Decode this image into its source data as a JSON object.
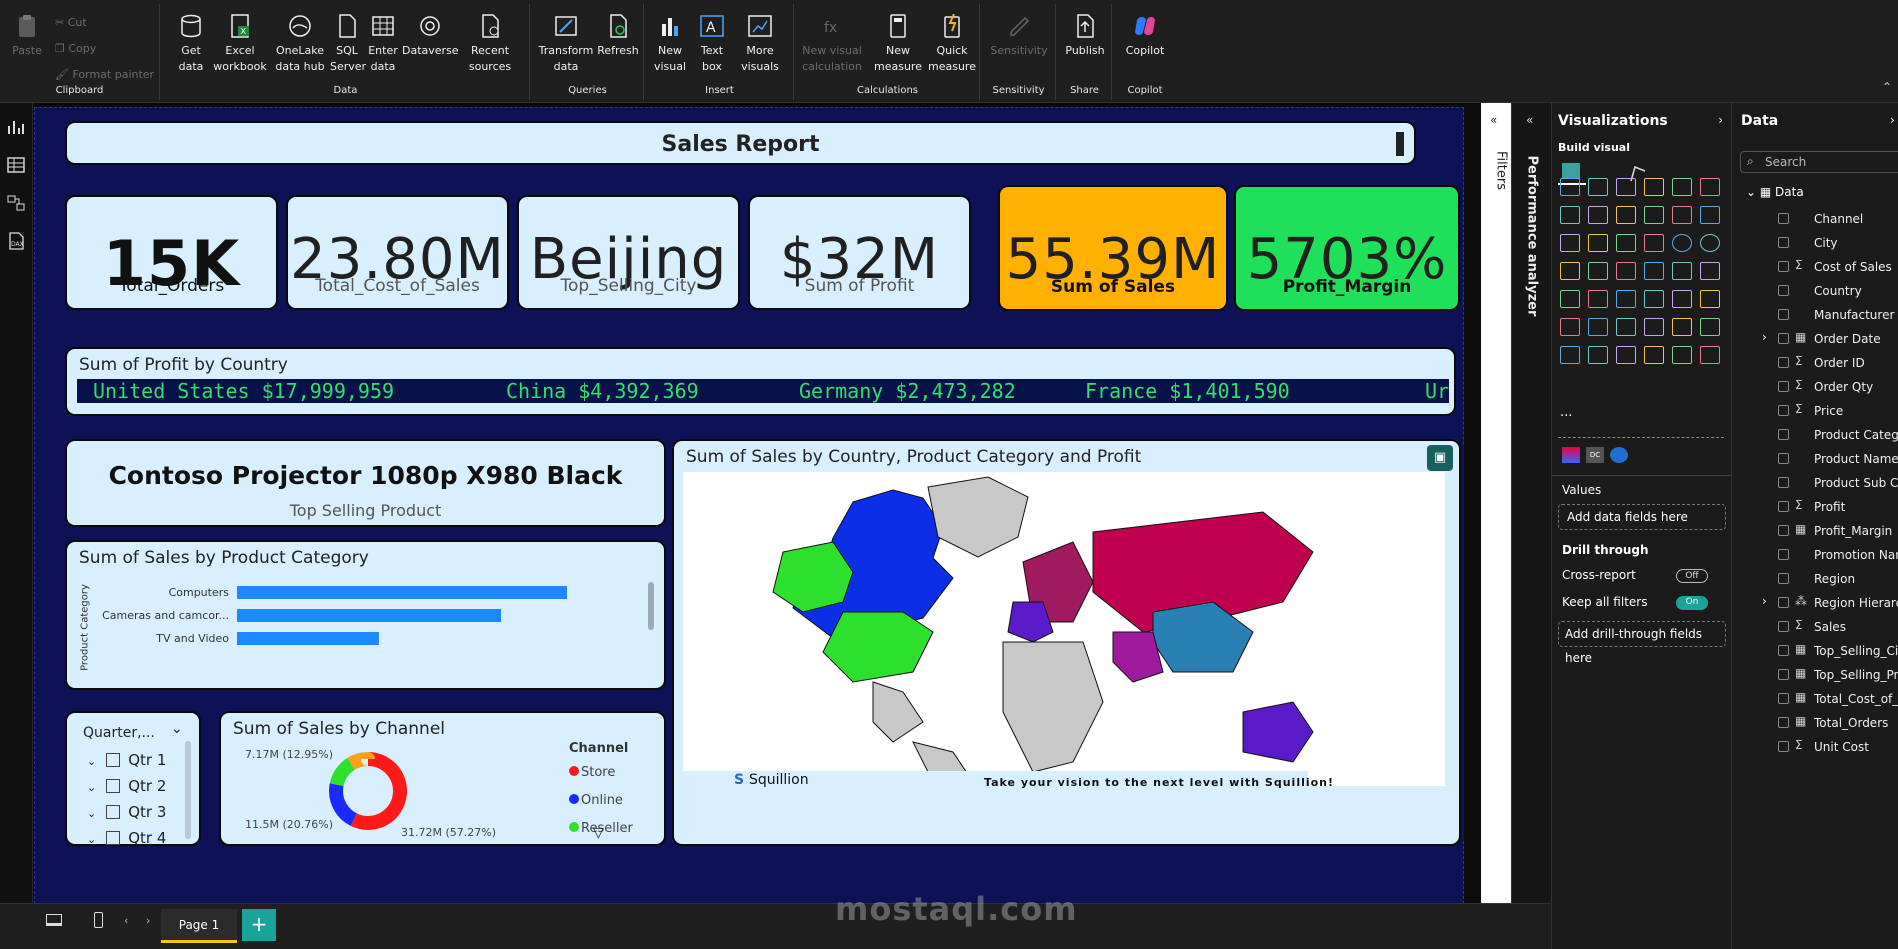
{
  "ribbon": {
    "clipboard": {
      "paste": "Paste",
      "cut": "Cut",
      "copy": "Copy",
      "format_painter": "Format painter",
      "group": "Clipboard"
    },
    "data": {
      "get_data": "Get data",
      "excel": "Excel workbook",
      "onelake": "OneLake data hub",
      "sql": "SQL Server",
      "enter": "Enter data",
      "dataverse": "Dataverse",
      "recent": "Recent sources",
      "group": "Data"
    },
    "queries": {
      "transform": "Transform data",
      "refresh": "Refresh",
      "group": "Queries"
    },
    "insert": {
      "new_visual": "New visual",
      "text_box": "Text box",
      "more_visuals": "More visuals",
      "group": "Insert"
    },
    "calculations": {
      "new_visual_calc": "New visual calculation",
      "new_measure": "New measure",
      "quick_measure": "Quick measure",
      "group": "Calculations"
    },
    "sensitivity": {
      "label": "Sensitivity",
      "group": "Sensitivity"
    },
    "share": {
      "publish": "Publish",
      "group": "Share"
    },
    "copilot": {
      "label": "Copilot",
      "group": "Copilot"
    }
  },
  "report": {
    "title": "Sales Report",
    "kpis": [
      {
        "value": "15K",
        "label": "Total_Orders"
      },
      {
        "value": "23.80M",
        "label": "Total_Cost_of_Sales"
      },
      {
        "value": "Beijing",
        "label": "Top_Selling_City"
      },
      {
        "value": "$32M",
        "label": "Sum of Profit"
      },
      {
        "value": "55.39M",
        "label": "Sum of Sales"
      },
      {
        "value": "5703%",
        "label": "Profit_Margin"
      }
    ],
    "ticker": {
      "title": "Sum of Profit by Country",
      "items": [
        "United States $17,999,959",
        "China $4,392,369",
        "Germany $2,473,282",
        "France $1,401,590",
        "Ur"
      ]
    },
    "top_product": {
      "value": "Contoso Projector 1080p X980 Black",
      "label": "Top Selling Product"
    },
    "map": {
      "title": "Sum of Sales by Country, Product Category and Profit",
      "brand": "Squillion",
      "tagline": "Take your vision to the next level with Squillion!"
    },
    "slicer": {
      "title": "Quarter,...",
      "items": [
        "Qtr 1",
        "Qtr 2",
        "Qtr 3",
        "Qtr 4"
      ]
    }
  },
  "chart_data": [
    {
      "type": "bar",
      "title": "Sum of Sales by Product Category",
      "ylabel": "Product Category",
      "categories": [
        "Computers",
        "Cameras and camcor...",
        "TV and Video"
      ],
      "values": [
        100,
        80,
        43
      ],
      "color": "#1e88ff"
    },
    {
      "type": "pie",
      "title": "Sum of Sales by Channel",
      "legend_title": "Channel",
      "labels": [
        "Store",
        "Online",
        "Reseller"
      ],
      "values": [
        31.72,
        11.5,
        7.17
      ],
      "data_labels": [
        "31.72M (57.27%)",
        "11.5M (20.76%)",
        "7.17M (12.95%)"
      ],
      "colors": [
        "#ff1a1a",
        "#1a2bff",
        "#2ee02e",
        "#ff9f1a"
      ]
    }
  ],
  "panes": {
    "filters": "Filters",
    "performance": "Performance analyzer",
    "visualizations": {
      "title": "Visualizations",
      "build": "Build visual",
      "values": "Values",
      "add_data": "Add data fields here",
      "drill": "Drill through",
      "cross": "Cross-report",
      "cross_state": "Off",
      "keep": "Keep all filters",
      "keep_state": "On",
      "add_drill": "Add drill-through fields here"
    },
    "data": {
      "title": "Data",
      "search_placeholder": "Search",
      "table": "Data",
      "fields": [
        {
          "sig": "",
          "name": "Channel"
        },
        {
          "sig": "",
          "name": "City"
        },
        {
          "sig": "Σ",
          "name": "Cost of Sales"
        },
        {
          "sig": "",
          "name": "Country"
        },
        {
          "sig": "",
          "name": "Manufacturer"
        },
        {
          "sig": "▦",
          "name": "Order Date"
        },
        {
          "sig": "Σ",
          "name": "Order ID"
        },
        {
          "sig": "Σ",
          "name": "Order Qty"
        },
        {
          "sig": "Σ",
          "name": "Price"
        },
        {
          "sig": "",
          "name": "Product Category"
        },
        {
          "sig": "",
          "name": "Product Name"
        },
        {
          "sig": "",
          "name": "Product Sub Ca..."
        },
        {
          "sig": "Σ",
          "name": "Profit"
        },
        {
          "sig": "▦",
          "name": "Profit_Margin"
        },
        {
          "sig": "",
          "name": "Promotion Name"
        },
        {
          "sig": "",
          "name": "Region"
        },
        {
          "sig": "⁂",
          "name": "Region Hierarchy"
        },
        {
          "sig": "Σ",
          "name": "Sales"
        },
        {
          "sig": "▦",
          "name": "Top_Selling_City"
        },
        {
          "sig": "▦",
          "name": "Top_Selling_Pro..."
        },
        {
          "sig": "▦",
          "name": "Total_Cost_of_S..."
        },
        {
          "sig": "▦",
          "name": "Total_Orders"
        },
        {
          "sig": "Σ",
          "name": "Unit Cost"
        }
      ]
    }
  },
  "footer": {
    "page": "Page 1",
    "add": "+",
    "watermark": "mostaql.com"
  }
}
